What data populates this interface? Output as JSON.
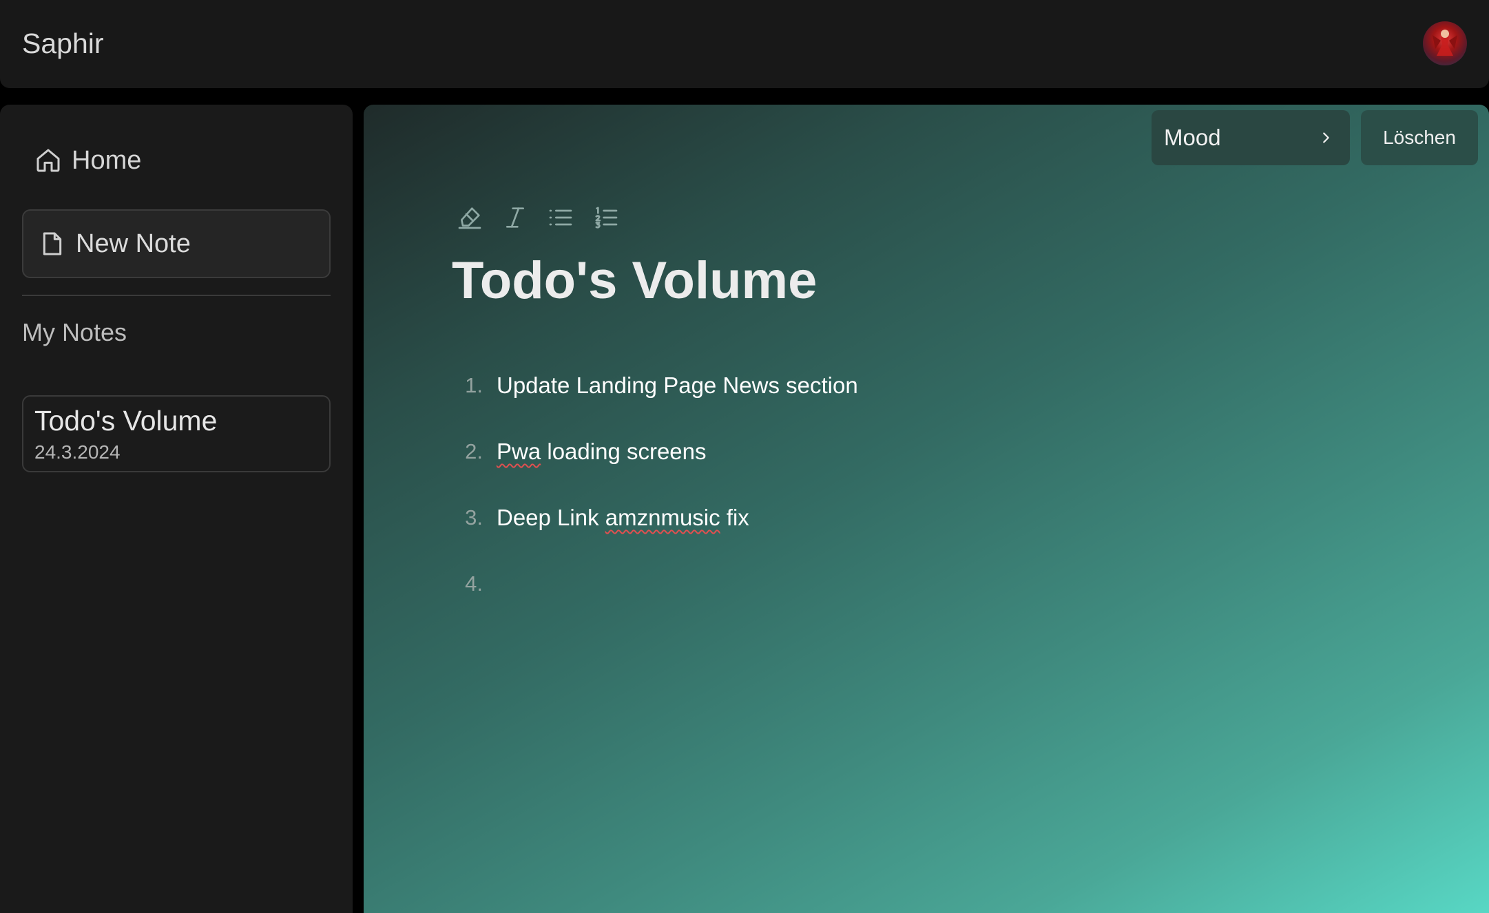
{
  "header": {
    "app_title": "Saphir"
  },
  "sidebar": {
    "home_label": "Home",
    "new_note_label": "New Note",
    "section_title": "My Notes",
    "notes": [
      {
        "title": "Todo's Volume",
        "date": "24.3.2024"
      }
    ]
  },
  "editor": {
    "mood_label": "Mood",
    "delete_label": "Löschen",
    "toolbar": [
      {
        "icon": "highlighter-icon"
      },
      {
        "icon": "italic-icon"
      },
      {
        "icon": "bullet-list-icon"
      },
      {
        "icon": "numbered-list-icon"
      }
    ],
    "title": "Todo's Volume",
    "list": [
      {
        "number": "1.",
        "text": "Update Landing Page News section"
      },
      {
        "number": "2.",
        "text_parts": [
          "Pwa",
          " loading screens"
        ]
      },
      {
        "number": "3.",
        "text_parts": [
          "Deep Link ",
          "amznmusic",
          " fix"
        ]
      },
      {
        "number": "4.",
        "text": ""
      }
    ]
  },
  "colors": {
    "background": "#000000",
    "panel": "#1a1a1a",
    "gradient_start": "#1f2b2a",
    "gradient_end": "#58d7c4",
    "button": "#2a4742"
  }
}
